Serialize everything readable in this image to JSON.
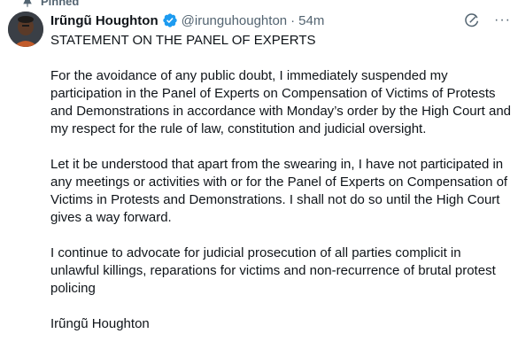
{
  "pinned_label": "Pinned",
  "author": {
    "name": "Irũngũ Houghton",
    "handle": "@irunguhoughton",
    "separator": "·",
    "time": "54m"
  },
  "colors": {
    "verified": "#1d9bf0",
    "secondary_text": "#536471",
    "primary_text": "#0f1419"
  },
  "icons": {
    "pin": "pin-icon",
    "verified": "verified-badge-icon",
    "grok": "grok-icon",
    "more": "more-icon"
  },
  "post": {
    "title": "STATEMENT ON THE PANEL OF EXPERTS",
    "paragraph_1": "For the avoidance of any public doubt, I immediately suspended my participation in the Panel of Experts on Compensation of Victims of Protests and Demonstrations in accordance with Monday’s order by the High Court and my respect for the rule of law, constitution and judicial oversight.",
    "paragraph_2": "Let it be understood that apart from the swearing in, I have not participated in any meetings or activities with or for the Panel of Experts on Compensation of Victims in Protests and Demonstrations. I shall not do so until the High Court gives a way forward.",
    "paragraph_3": "I continue to advocate for judicial prosecution of all parties complicit in unlawful killings, reparations for victims and non-recurrence of brutal protest policing",
    "signature": "Irũngũ Houghton"
  }
}
